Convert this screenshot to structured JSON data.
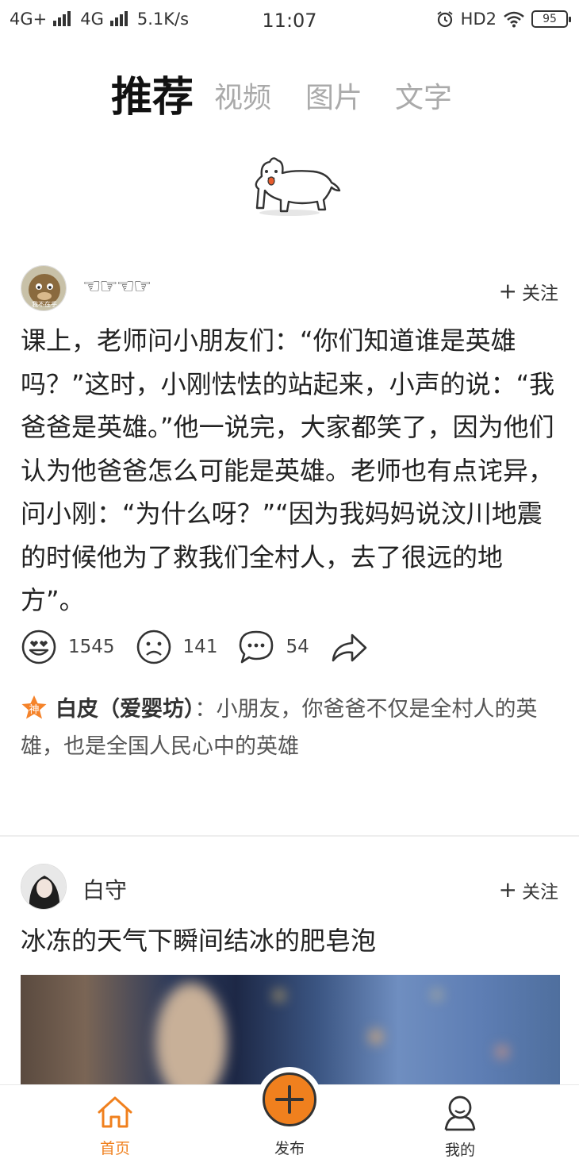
{
  "status_bar": {
    "net1": "4G+",
    "net2": "4G",
    "speed": "5.1K/s",
    "time": "11:07",
    "hd": "HD2",
    "battery": "95"
  },
  "top_tabs": [
    {
      "label": "推荐",
      "active": true
    },
    {
      "label": "视频",
      "active": false
    },
    {
      "label": "图片",
      "active": false
    },
    {
      "label": "文字",
      "active": false
    }
  ],
  "posts": [
    {
      "username": "☜☞☜☞",
      "follow_label": "关注",
      "content": "课上，老师问小朋友们：“你们知道谁是英雄吗？”这时，小刚怯怯的站起来，小声的说：“我爸爸是英雄。”他一说完，大家都笑了，因为他们认为他爸爸怎么可能是英雄。老师也有点诧异，问小刚：“为什么呀？”“因为我妈妈说汶川地震的时候他为了救我们全村人，去了很远的地方”。",
      "likes": "1545",
      "dislikes": "141",
      "comments": "54",
      "god_badge": "神",
      "top_comment": {
        "author": "白皮（爱婴坊）",
        "text": "：小朋友，你爸爸不仅是全村人的英雄，也是全国人民心中的英雄"
      },
      "avatar_caption": "我不在乎"
    },
    {
      "username": "白守",
      "follow_label": "关注",
      "title": "冰冻的天气下瞬间结冰的肥皂泡"
    }
  ],
  "bottom_nav": {
    "home": "首页",
    "publish": "发布",
    "me": "我的"
  },
  "colors": {
    "accent": "#f0801e"
  }
}
